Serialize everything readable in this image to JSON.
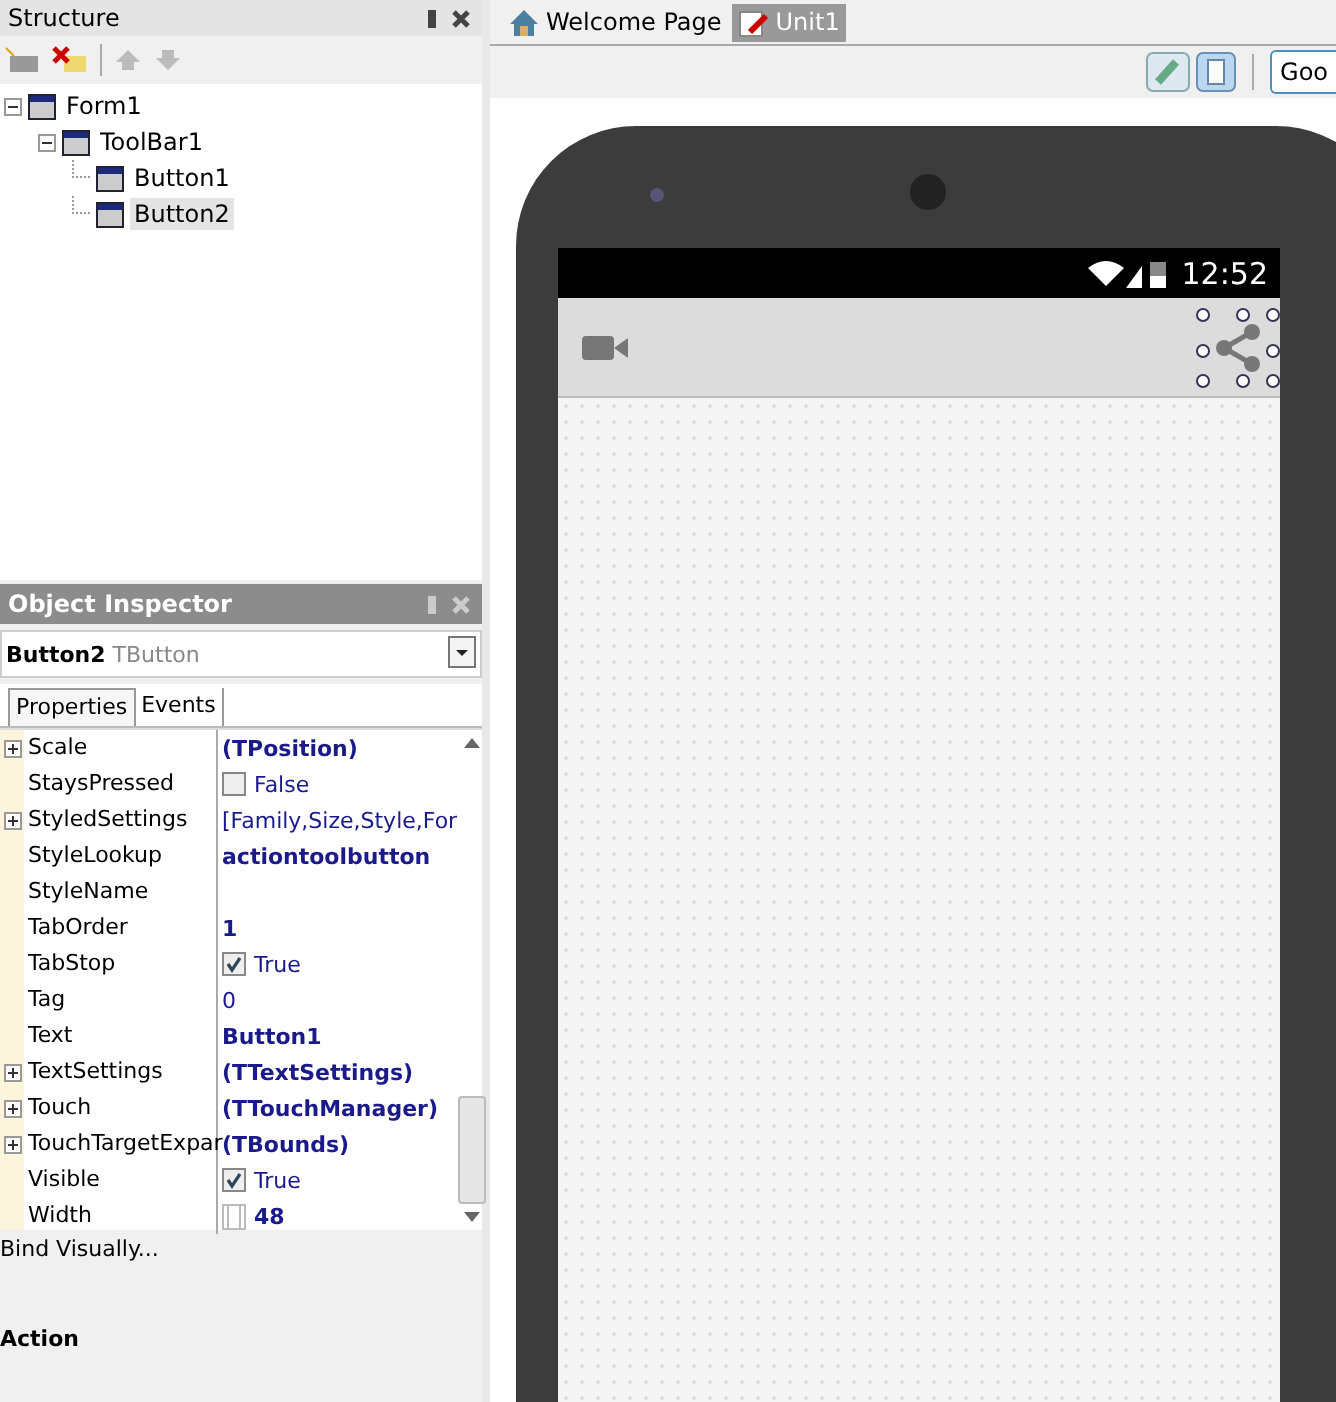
{
  "structure": {
    "title": "Structure",
    "tree": [
      {
        "label": "Form1",
        "expanded": true,
        "selected": false,
        "children": [
          {
            "label": "ToolBar1",
            "expanded": true,
            "selected": false,
            "children": [
              {
                "label": "Button1",
                "selected": false
              },
              {
                "label": "Button2",
                "selected": true
              }
            ]
          }
        ]
      }
    ]
  },
  "inspector": {
    "title": "Object Inspector",
    "object_name": "Button2",
    "object_type": "TButton",
    "tabs": [
      {
        "label": "Properties",
        "selected": true
      },
      {
        "label": "Events",
        "selected": false
      }
    ],
    "properties": [
      {
        "name": "Scale",
        "value": "(TPosition)",
        "kind": "text",
        "expandable": true,
        "bold": true
      },
      {
        "name": "StaysPressed",
        "value": "False",
        "kind": "check",
        "checked": false,
        "expandable": false,
        "bold": false
      },
      {
        "name": "StyledSettings",
        "value": "[Family,Size,Style,For",
        "kind": "text",
        "expandable": true,
        "bold": false
      },
      {
        "name": "StyleLookup",
        "value": "actiontoolbutton",
        "kind": "text",
        "expandable": false,
        "bold": true
      },
      {
        "name": "StyleName",
        "kind": "text",
        "expandable": false
      },
      {
        "name": "TabOrder",
        "value": "1",
        "kind": "text",
        "expandable": false,
        "bold": true
      },
      {
        "name": "TabStop",
        "value": "True",
        "kind": "check",
        "checked": true,
        "expandable": false,
        "bold": false
      },
      {
        "name": "Tag",
        "value": "0",
        "kind": "text",
        "expandable": false,
        "bold": false
      },
      {
        "name": "Text",
        "value": "Button1",
        "kind": "text",
        "expandable": false,
        "bold": true
      },
      {
        "name": "TextSettings",
        "value": "(TTextSettings)",
        "kind": "text",
        "expandable": true,
        "bold": true
      },
      {
        "name": "Touch",
        "value": "(TTouchManager)",
        "kind": "text",
        "expandable": true,
        "bold": true
      },
      {
        "name": "TouchTargetExpar",
        "value": "(TBounds)",
        "kind": "text",
        "expandable": true,
        "bold": true
      },
      {
        "name": "Visible",
        "value": "True",
        "kind": "check",
        "checked": true,
        "expandable": false,
        "bold": false
      },
      {
        "name": "Width",
        "value": "48",
        "kind": "size",
        "expandable": false,
        "bold": true
      }
    ],
    "bind_link": "Bind Visually...",
    "section_label": "Action"
  },
  "editor_tabs": [
    {
      "label": "Welcome Page",
      "kind": "home",
      "selected": false
    },
    {
      "label": "Unit1",
      "kind": "unit",
      "selected": true
    }
  ],
  "view_button": "Goo",
  "phone": {
    "time": "12:52"
  }
}
